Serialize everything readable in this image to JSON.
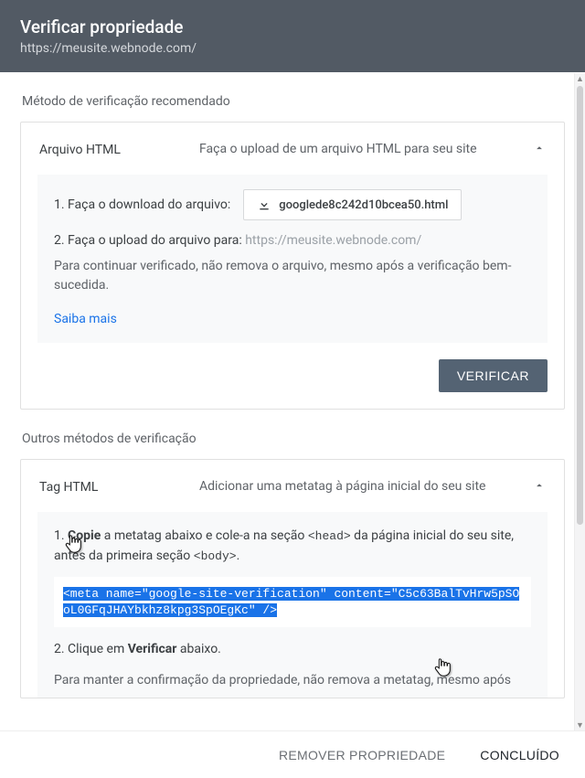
{
  "header": {
    "title": "Verificar propriedade",
    "subtitle": "https://meusite.webnode.com/"
  },
  "sections": {
    "recommended_heading": "Método de verificação recomendado",
    "other_heading": "Outros métodos de verificação"
  },
  "methods": {
    "html_file": {
      "title": "Arquivo HTML",
      "description": "Faça o upload de um arquivo HTML para seu site",
      "step1_label": "1. Faça o download do arquivo:",
      "download_filename": "googlede8c242d10bcea50.html",
      "step2_label": "2. Faça o upload do arquivo para:",
      "upload_target": "https://meusite.webnode.com/",
      "keep_note": "Para continuar verificado, não remova o arquivo, mesmo após a verificação bem-sucedida.",
      "learn_more": "Saiba mais",
      "verify_label": "VERIFICAR"
    },
    "html_tag": {
      "title": "Tag HTML",
      "description": "Adicionar uma metatag à página inicial do seu site",
      "step1_prefix": "1. ",
      "step1_bold": "Copie",
      "step1_mid": " a metatag abaixo e cole-a na seção ",
      "head_tag": "<head>",
      "step1_mid2": " da página inicial do seu site, antes da primeira seção ",
      "body_tag": "<body>",
      "meta_code": "<meta name=\"google-site-verification\" content=\"C5c63BalTvHrw5pSOoL0GFqJHAYbkhz8kpg3SpOEgKc\" />",
      "step2_prefix": "2. Clique em ",
      "step2_bold": "Verificar",
      "step2_suffix": " abaixo.",
      "keep_note": "Para manter a confirmação da propriedade, não remova a metatag, mesmo após"
    }
  },
  "footer": {
    "remove_label": "REMOVER PROPRIEDADE",
    "done_label": "CONCLUÍDO"
  }
}
